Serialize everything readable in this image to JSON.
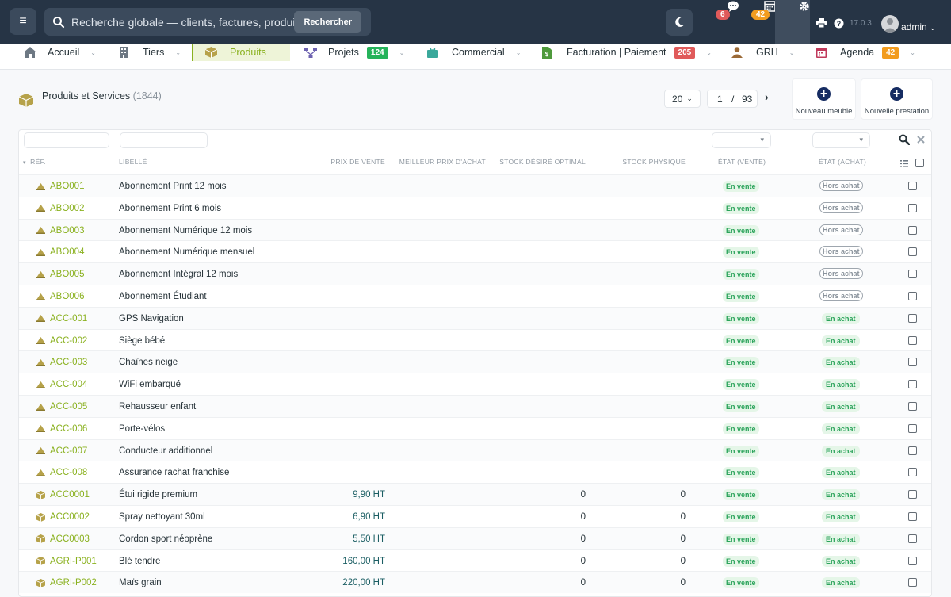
{
  "topbar": {
    "search_placeholder": "Recherche globale — clients, factures, produits...",
    "search_button": "Rechercher",
    "messages_badge": "6",
    "agenda_badge": "42",
    "version": "17.0.3",
    "user": "admin"
  },
  "nav": [
    {
      "label": "Accueil"
    },
    {
      "label": "Tiers"
    },
    {
      "label": "Produits"
    },
    {
      "label": "Projets",
      "badge": "124"
    },
    {
      "label": "Commercial"
    },
    {
      "label": "Facturation | Paiement",
      "badge": "205"
    },
    {
      "label": "GRH"
    },
    {
      "label": "Agenda",
      "badge": "42"
    }
  ],
  "page": {
    "title": "Produits et Services",
    "count": "(1844)",
    "limit": "20",
    "page_current": "1",
    "page_sep": "/",
    "page_total": "93",
    "btn_new_furniture": "Nouveau meuble",
    "btn_new_service": "Nouvelle prestation"
  },
  "columns": {
    "ref": "RÉF.",
    "label": "LIBELLÉ",
    "sell_price": "PRIX DE VENTE",
    "best_buy_price": "MEILLEUR PRIX D'ACHAT",
    "stock_desired": "STOCK DÉSIRÉ OPTIMAL",
    "stock_physical": "STOCK PHYSIQUE",
    "status_sell": "ÉTAT (VENTE)",
    "status_buy": "ÉTAT (ACHAT)"
  },
  "rows": [
    {
      "type": "service",
      "ref": "ABO001",
      "label": "Abonnement Print 12 mois",
      "price": "",
      "stock_d": "",
      "stock_p": "",
      "sell": "En vente",
      "buy": "Hors achat"
    },
    {
      "type": "service",
      "ref": "ABO002",
      "label": "Abonnement Print 6 mois",
      "price": "",
      "stock_d": "",
      "stock_p": "",
      "sell": "En vente",
      "buy": "Hors achat"
    },
    {
      "type": "service",
      "ref": "ABO003",
      "label": "Abonnement Numérique 12 mois",
      "price": "",
      "stock_d": "",
      "stock_p": "",
      "sell": "En vente",
      "buy": "Hors achat"
    },
    {
      "type": "service",
      "ref": "ABO004",
      "label": "Abonnement Numérique mensuel",
      "price": "",
      "stock_d": "",
      "stock_p": "",
      "sell": "En vente",
      "buy": "Hors achat"
    },
    {
      "type": "service",
      "ref": "ABO005",
      "label": "Abonnement Intégral 12 mois",
      "price": "",
      "stock_d": "",
      "stock_p": "",
      "sell": "En vente",
      "buy": "Hors achat"
    },
    {
      "type": "service",
      "ref": "ABO006",
      "label": "Abonnement Étudiant",
      "price": "",
      "stock_d": "",
      "stock_p": "",
      "sell": "En vente",
      "buy": "Hors achat"
    },
    {
      "type": "service",
      "ref": "ACC-001",
      "label": "GPS Navigation",
      "price": "",
      "stock_d": "",
      "stock_p": "",
      "sell": "En vente",
      "buy": "En achat"
    },
    {
      "type": "service",
      "ref": "ACC-002",
      "label": "Siège bébé",
      "price": "",
      "stock_d": "",
      "stock_p": "",
      "sell": "En vente",
      "buy": "En achat"
    },
    {
      "type": "service",
      "ref": "ACC-003",
      "label": "Chaînes neige",
      "price": "",
      "stock_d": "",
      "stock_p": "",
      "sell": "En vente",
      "buy": "En achat"
    },
    {
      "type": "service",
      "ref": "ACC-004",
      "label": "WiFi embarqué",
      "price": "",
      "stock_d": "",
      "stock_p": "",
      "sell": "En vente",
      "buy": "En achat"
    },
    {
      "type": "service",
      "ref": "ACC-005",
      "label": "Rehausseur enfant",
      "price": "",
      "stock_d": "",
      "stock_p": "",
      "sell": "En vente",
      "buy": "En achat"
    },
    {
      "type": "service",
      "ref": "ACC-006",
      "label": "Porte-vélos",
      "price": "",
      "stock_d": "",
      "stock_p": "",
      "sell": "En vente",
      "buy": "En achat"
    },
    {
      "type": "service",
      "ref": "ACC-007",
      "label": "Conducteur additionnel",
      "price": "",
      "stock_d": "",
      "stock_p": "",
      "sell": "En vente",
      "buy": "En achat"
    },
    {
      "type": "service",
      "ref": "ACC-008",
      "label": "Assurance rachat franchise",
      "price": "",
      "stock_d": "",
      "stock_p": "",
      "sell": "En vente",
      "buy": "En achat"
    },
    {
      "type": "product",
      "ref": "ACC0001",
      "label": "Étui rigide premium",
      "price": "9,90 HT",
      "stock_d": "0",
      "stock_p": "0",
      "sell": "En vente",
      "buy": "En achat"
    },
    {
      "type": "product",
      "ref": "ACC0002",
      "label": "Spray nettoyant 30ml",
      "price": "6,90 HT",
      "stock_d": "0",
      "stock_p": "0",
      "sell": "En vente",
      "buy": "En achat"
    },
    {
      "type": "product",
      "ref": "ACC0003",
      "label": "Cordon sport néoprène",
      "price": "5,50 HT",
      "stock_d": "0",
      "stock_p": "0",
      "sell": "En vente",
      "buy": "En achat"
    },
    {
      "type": "product",
      "ref": "AGRI-P001",
      "label": "Blé tendre",
      "price": "160,00 HT",
      "stock_d": "0",
      "stock_p": "0",
      "sell": "En vente",
      "buy": "En achat"
    },
    {
      "type": "product",
      "ref": "AGRI-P002",
      "label": "Maïs grain",
      "price": "220,00 HT",
      "stock_d": "0",
      "stock_p": "0",
      "sell": "En vente",
      "buy": "En achat"
    }
  ],
  "colors": {
    "accent": "#8ab11f",
    "topbar": "#263445",
    "badge_red": "#e05a5a",
    "badge_green": "#25b35a",
    "badge_orange": "#f29c1f"
  }
}
